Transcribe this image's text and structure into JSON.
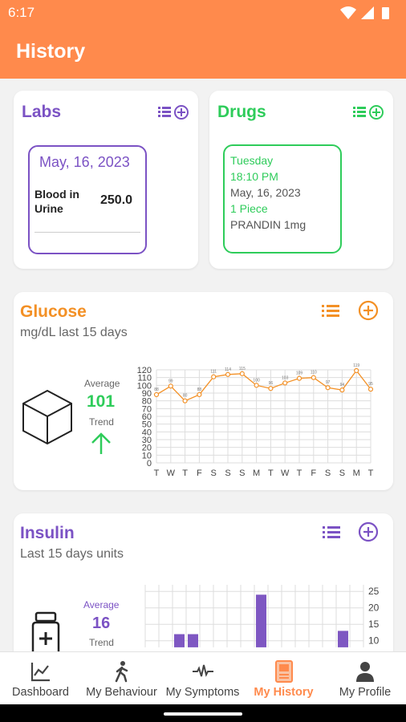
{
  "status": {
    "time": "6:17"
  },
  "header": {
    "title": "History"
  },
  "labs": {
    "title": "Labs",
    "date": "May, 16, 2023",
    "test_name": "Blood in Urine",
    "value": "250.0"
  },
  "drugs": {
    "title": "Drugs",
    "day": "Tuesday",
    "time": "18:10 PM",
    "date": "May, 16, 2023",
    "dose": "1 Piece",
    "name": "PRANDIN 1mg"
  },
  "glucose": {
    "title": "Glucose",
    "subtitle": "mg/dL last 15 days",
    "average_label": "Average",
    "average": "101",
    "trend_label": "Trend",
    "chart_data": {
      "type": "line",
      "categories": [
        "T",
        "W",
        "T",
        "F",
        "S",
        "S",
        "S",
        "M",
        "T",
        "W",
        "T",
        "F",
        "S",
        "S",
        "M",
        "T"
      ],
      "values": [
        88,
        99,
        80,
        88,
        111,
        114,
        115,
        100,
        96,
        103,
        109,
        110,
        97,
        94,
        119,
        95
      ],
      "ylim": [
        0,
        120
      ],
      "yticks": [
        0,
        10,
        20,
        30,
        40,
        50,
        60,
        70,
        80,
        90,
        100,
        110,
        120
      ],
      "grid": true
    }
  },
  "insulin": {
    "title": "Insulin",
    "subtitle": "Last 15 days units",
    "average_label": "Average",
    "average": "16",
    "trend_label": "Trend",
    "chart_data": {
      "type": "bar",
      "values": [
        0,
        4,
        12,
        12,
        0,
        4,
        0,
        7,
        24,
        3,
        7,
        0,
        0,
        0,
        13,
        0
      ],
      "ylim": [
        8,
        27
      ],
      "yticks": [
        10,
        15,
        20,
        25
      ],
      "grid": true
    }
  },
  "nav": [
    {
      "label": "Dashboard",
      "icon": "chart-icon"
    },
    {
      "label": "My Behaviour",
      "icon": "walk-icon"
    },
    {
      "label": "My Symptoms",
      "icon": "pulse-icon"
    },
    {
      "label": "My History",
      "icon": "history-book-icon",
      "active": true
    },
    {
      "label": "My Profile",
      "icon": "person-icon"
    }
  ],
  "colors": {
    "orange": "#ff8a4c",
    "purple": "#7b52c4",
    "green": "#2ecc5a",
    "accent_orange": "#f39025"
  }
}
